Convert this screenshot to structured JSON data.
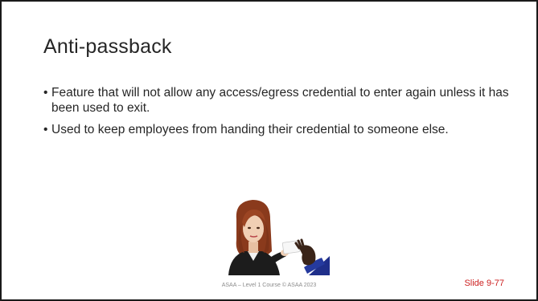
{
  "slide": {
    "title": "Anti-passback",
    "bullets": [
      {
        "marker": "•",
        "text": "Feature that will not allow any access/egress credential to enter again unless it has been used to exit."
      },
      {
        "marker": "•",
        "text": "Used to keep employees from handing their credential to someone else."
      }
    ],
    "illustration": {
      "icon": "person-handing-card-photo"
    },
    "footer": "ASAA – Level 1 Course © ASAA 2023",
    "slide_number": "Slide 9-77"
  },
  "colors": {
    "title": "#262626",
    "body_text": "#262626",
    "footer_text": "#8c8c8c",
    "slide_number": "#cc1f1f",
    "border": "#1a1a1a"
  }
}
